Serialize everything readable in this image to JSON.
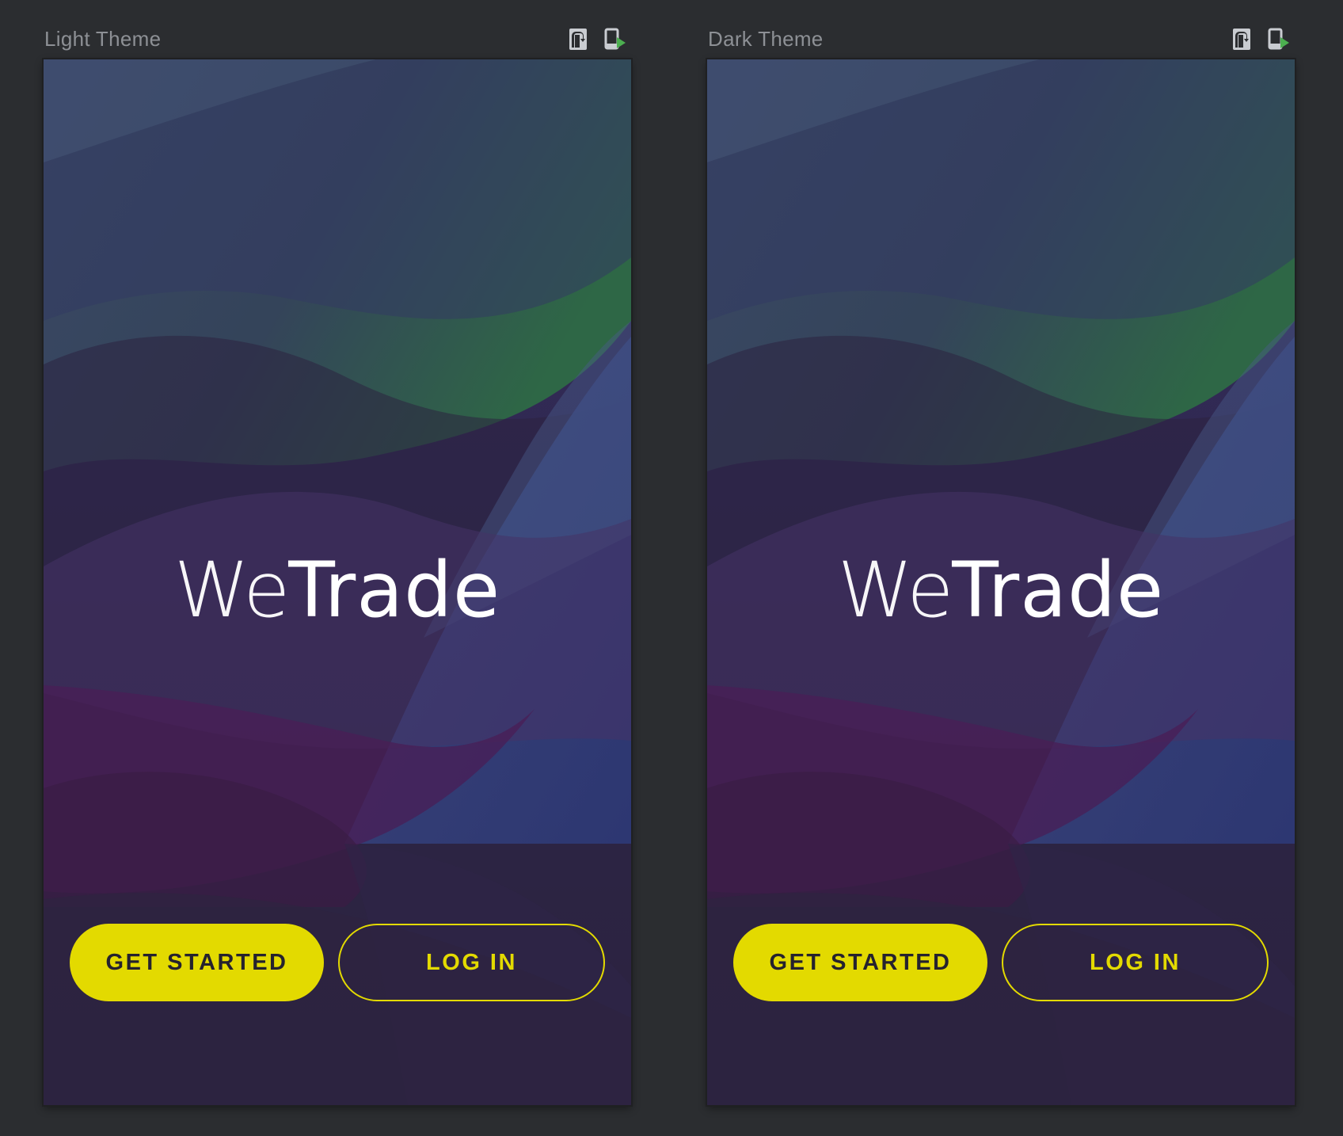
{
  "colors": {
    "ide_background": "#2b2d30",
    "pane_title_text": "#8d9095",
    "accent_yellow": "#e3da00",
    "button_dark_text": "#25222e",
    "logo_text": "#ffffff",
    "run_icon_green": "#4caf50"
  },
  "panes": [
    {
      "title": "Light Theme",
      "icons": [
        "orientation-icon",
        "run-on-device-icon"
      ],
      "app": {
        "logo_light": "We",
        "logo_bold": "Trade",
        "primary_button": "GET STARTED",
        "secondary_button": "LOG IN"
      }
    },
    {
      "title": "Dark Theme",
      "icons": [
        "orientation-icon",
        "run-on-device-icon"
      ],
      "app": {
        "logo_light": "We",
        "logo_bold": "Trade",
        "primary_button": "GET STARTED",
        "secondary_button": "LOG IN"
      }
    }
  ]
}
